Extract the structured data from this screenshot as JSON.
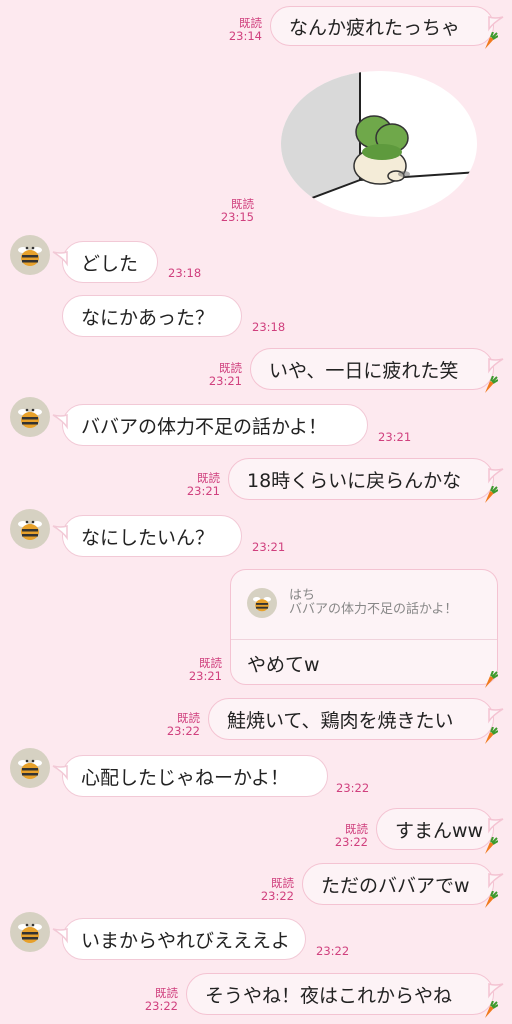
{
  "read_label": "既読",
  "reply": {
    "name": "はち",
    "quoted": "ババアの体力不足の話かよ！",
    "text": "やめてw",
    "read": "既読",
    "time": "23:21"
  },
  "messages": [
    {
      "id": "m1",
      "dir": "out",
      "text": "なんか疲れたっちゃ",
      "time": "23:14",
      "read": "既読"
    },
    {
      "id": "m2",
      "dir": "out",
      "sticker": "frog-in-corner-sticker",
      "time": "23:15",
      "read": "既読"
    },
    {
      "id": "m3",
      "dir": "in",
      "text": "どした",
      "time": "23:18"
    },
    {
      "id": "m4",
      "dir": "in",
      "text": "なにかあった？",
      "time": "23:18"
    },
    {
      "id": "m5",
      "dir": "out",
      "text": "いや、一日に疲れた笑",
      "time": "23:21",
      "read": "既読"
    },
    {
      "id": "m6",
      "dir": "in",
      "text": "ババアの体力不足の話かよ！",
      "time": "23:21"
    },
    {
      "id": "m7",
      "dir": "out",
      "text": "18時くらいに戻らんかな",
      "time": "23:21",
      "read": "既読"
    },
    {
      "id": "m8",
      "dir": "in",
      "text": "なにしたいん？",
      "time": "23:21"
    },
    {
      "id": "m9",
      "dir": "out",
      "text": "鮭焼いて、鶏肉を焼きたい",
      "time": "23:22",
      "read": "既読"
    },
    {
      "id": "m10",
      "dir": "in",
      "text": "心配したじゃねーかよ！",
      "time": "23:22"
    },
    {
      "id": "m11",
      "dir": "out",
      "text": "すまんww",
      "time": "23:22",
      "read": "既読"
    },
    {
      "id": "m12",
      "dir": "out",
      "text": "ただのババアでw",
      "time": "23:22",
      "read": "既読"
    },
    {
      "id": "m13",
      "dir": "in",
      "text": "いまからやれびえええよ",
      "time": "23:22"
    },
    {
      "id": "m14",
      "dir": "out",
      "text": "そうやね！夜はこれからやね",
      "time": "23:22",
      "read": "既読"
    }
  ],
  "icons": {
    "avatar": "bee-avatar-icon",
    "reaction": "carrot-icon"
  },
  "colors": {
    "background": "#fde9ef",
    "accent": "#d0407e"
  }
}
